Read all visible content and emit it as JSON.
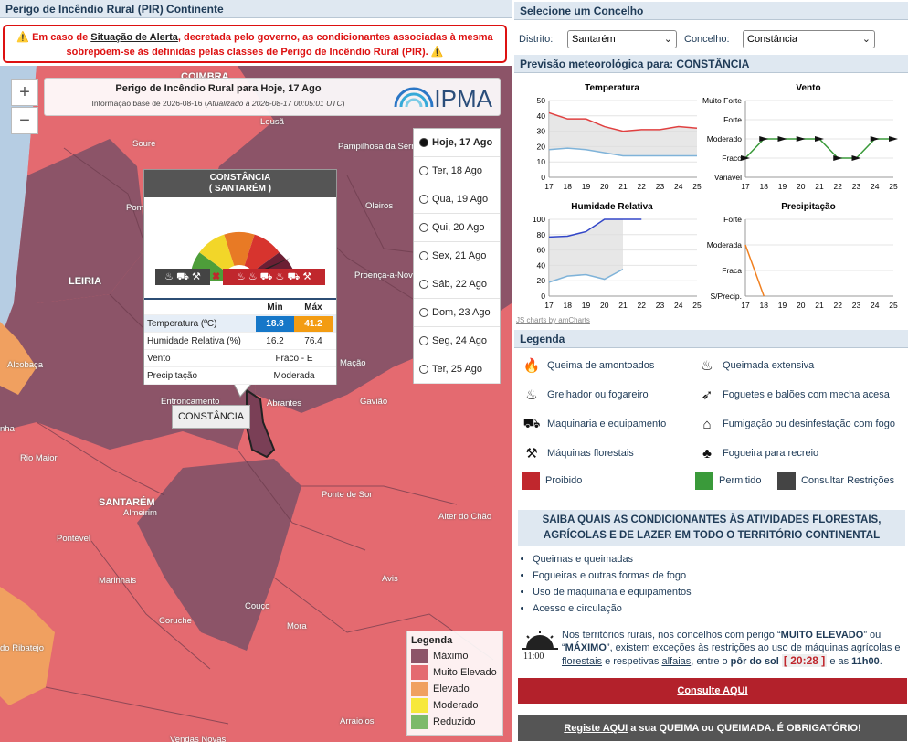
{
  "left": {
    "header": "Perigo de Incêndio Rural (PIR) Continente",
    "alert": {
      "before": "Em caso de ",
      "link": "Situação de Alerta",
      "after": ", decretada pelo governo, as condicionantes associadas à mesma sobrepõem-se às definidas pelas classes de Perigo de Incêndio Rural (PIR)."
    },
    "zoom_in": "+",
    "zoom_out": "−",
    "map_title": "Perigo de Incêndio Rural para Hoje, 17 Ago",
    "map_info_before": "Informação base de 2026-08-16 (",
    "map_info_updated": "Atualizado a 2026-08-17 00:05:01 UTC",
    "map_info_after": ")",
    "logo": "IPMA",
    "days": [
      {
        "label": "Hoje, 17 Ago",
        "selected": true,
        "bold": true
      },
      {
        "label": "Ter, 18 Ago"
      },
      {
        "label": "Qua, 19 Ago"
      },
      {
        "label": "Qui, 20 Ago"
      },
      {
        "label": "Sex, 21 Ago"
      },
      {
        "label": "Sáb, 22 Ago"
      },
      {
        "label": "Dom, 23 Ago"
      },
      {
        "label": "Seg, 24 Ago"
      },
      {
        "label": "Ter, 25 Ago"
      }
    ],
    "popup": {
      "municipality": "CONSTÂNCIA",
      "district": "( SANTARÉM )",
      "col_min": "Min",
      "col_max": "Máx",
      "rows": [
        {
          "label": "Temperatura (ºC)",
          "min": "18.8",
          "max": "41.2"
        },
        {
          "label": "Humidade Relativa (%)",
          "min": "16.2",
          "max": "76.4"
        },
        {
          "label": "Vento",
          "value": "Fraco - E"
        },
        {
          "label": "Precipitação",
          "value": "Moderada"
        }
      ],
      "min_color": "#1677c8",
      "max_color": "#f39c12"
    },
    "map_label": "CONSTÂNCIA",
    "places": [
      "COIMBRA",
      "Lousã",
      "Soure",
      "Pampilhosa da Serra",
      "Pombal",
      "Oleiros",
      "LEIRIA",
      "Proença-a-Nova",
      "Alcobaça",
      "Mação",
      "Entroncamento",
      "Abrantes",
      "Gavião",
      "Rio Maior",
      "SANTARÉM",
      "Almeirim",
      "Ponte de Sor",
      "Alter do Chão",
      "Pontével",
      "Marinhais",
      "Avis",
      "Coruche",
      "Couço",
      "Mora",
      "do Ribatejo",
      "Arraiolos",
      "Vendas Novas",
      "nha"
    ],
    "map_legend": {
      "title": "Legenda",
      "items": [
        {
          "label": "Máximo",
          "color": "#8c5468"
        },
        {
          "label": "Muito Elevado",
          "color": "#e46a70"
        },
        {
          "label": "Elevado",
          "color": "#f0a060"
        },
        {
          "label": "Moderado",
          "color": "#f7e83a"
        },
        {
          "label": "Reduzido",
          "color": "#7dba6a"
        }
      ]
    }
  },
  "right": {
    "select_header": "Selecione um Concelho",
    "district_label": "Distrito:",
    "district_value": "Santarém",
    "municipality_label": "Concelho:",
    "municipality_value": "Constância",
    "forecast_header": "Previsão meteorológica para: CONSTÂNCIA",
    "credit": "JS charts by amCharts",
    "legend_header": "Legenda",
    "legend_items": [
      {
        "label": "Queima de amontoados",
        "icon": "pile-burning-icon"
      },
      {
        "label": "Queimada extensiva",
        "icon": "extensive-burn-icon"
      },
      {
        "label": "Grelhador ou fogareiro",
        "icon": "grill-icon"
      },
      {
        "label": "Foguetes e balões com mecha acesa",
        "icon": "rocket-icon"
      },
      {
        "label": "Maquinaria e equipamento",
        "icon": "tractor-icon"
      },
      {
        "label": "Fumigação ou desinfestação com fogo",
        "icon": "fumigation-icon"
      },
      {
        "label": "Máquinas florestais",
        "icon": "chainsaw-icon"
      },
      {
        "label": "Fogueira para recreio",
        "icon": "campfire-icon"
      }
    ],
    "status_items": [
      {
        "label": "Proibido",
        "color": "#c0272d"
      },
      {
        "label": "Permitido",
        "color": "#3a9a3a"
      },
      {
        "label": "Consultar Restrições",
        "color": "#444444"
      }
    ],
    "saiba": "SAIBA QUAIS AS CONDICIONANTES ÀS ATIVIDADES FLORESTAIS, AGRÍCOLAS E DE LAZER EM TODO O TERRITÓRIO CONTINENTAL",
    "bullets": [
      "Queimas e queimadas",
      "Fogueiras e outras formas de fogo",
      "Uso de maquinaria e equipamentos",
      "Acesso e circulação"
    ],
    "note_time": "11:00",
    "note": {
      "p1": "Nos territórios rurais, nos concelhos com perigo “",
      "b1": "MUITO ELEVADO",
      "p2": "” ou “",
      "b2": "MÁXIMO",
      "p3": "”, existem exceções às restrições ao uso de máquinas ",
      "u1": "agrícolas e florestais",
      "p4": " e respetivas ",
      "u2": "alfaias",
      "p5": ", entre o ",
      "b3": "pôr do sol",
      "time": "[ 20:28 ]",
      "p6": " e as ",
      "b4": "11h00",
      "p7": "."
    },
    "consult_button": "Consulte AQUI",
    "register": {
      "link": "Registe AQUI",
      "rest": " a sua QUEIMA ou QUEIMADA. É OBRIGATÓRIO!"
    }
  },
  "chart_data": [
    {
      "type": "line",
      "title": "Temperatura",
      "x": [
        17,
        18,
        19,
        20,
        21,
        22,
        23,
        24,
        25
      ],
      "ylim": [
        0,
        50
      ],
      "yticks": [
        0,
        10,
        20,
        30,
        40,
        50
      ],
      "series": [
        {
          "values": [
            42,
            38,
            38,
            33,
            30,
            31,
            31,
            33,
            32
          ],
          "color": "#e04040"
        },
        {
          "values": [
            18,
            19,
            18,
            16,
            14,
            14,
            14,
            14,
            14
          ],
          "color": "#7fb3d9"
        }
      ]
    },
    {
      "type": "line",
      "title": "Vento",
      "x": [
        17,
        18,
        19,
        20,
        21,
        22,
        23,
        24,
        25
      ],
      "ylabels": [
        "Variável",
        "Fraco",
        "Moderado",
        "Forte",
        "Muito Forte"
      ],
      "series": [
        {
          "values": [
            1,
            2,
            2,
            2,
            2,
            1,
            1,
            2,
            2
          ],
          "color": "#3a9a3a"
        }
      ]
    },
    {
      "type": "line",
      "title": "Humidade Relativa",
      "x": [
        17,
        18,
        19,
        20,
        21,
        22,
        23,
        24,
        25
      ],
      "ylim": [
        0,
        100
      ],
      "yticks": [
        0,
        20,
        40,
        60,
        80,
        100
      ],
      "series": [
        {
          "values": [
            77,
            78,
            84,
            100,
            100,
            100,
            null,
            null,
            null
          ],
          "color": "#3347c8"
        },
        {
          "values": [
            18,
            26,
            28,
            22,
            35,
            null,
            null,
            null,
            null
          ],
          "color": "#7fb3d9"
        }
      ]
    },
    {
      "type": "line",
      "title": "Precipitação",
      "x": [
        17,
        18,
        19,
        20,
        21,
        22,
        23,
        24,
        25
      ],
      "ylabels": [
        "S/Precip.",
        "Fraca",
        "Moderada",
        "Forte"
      ],
      "series": [
        {
          "values": [
            2,
            0
          ],
          "color": "#f08020"
        }
      ]
    }
  ]
}
